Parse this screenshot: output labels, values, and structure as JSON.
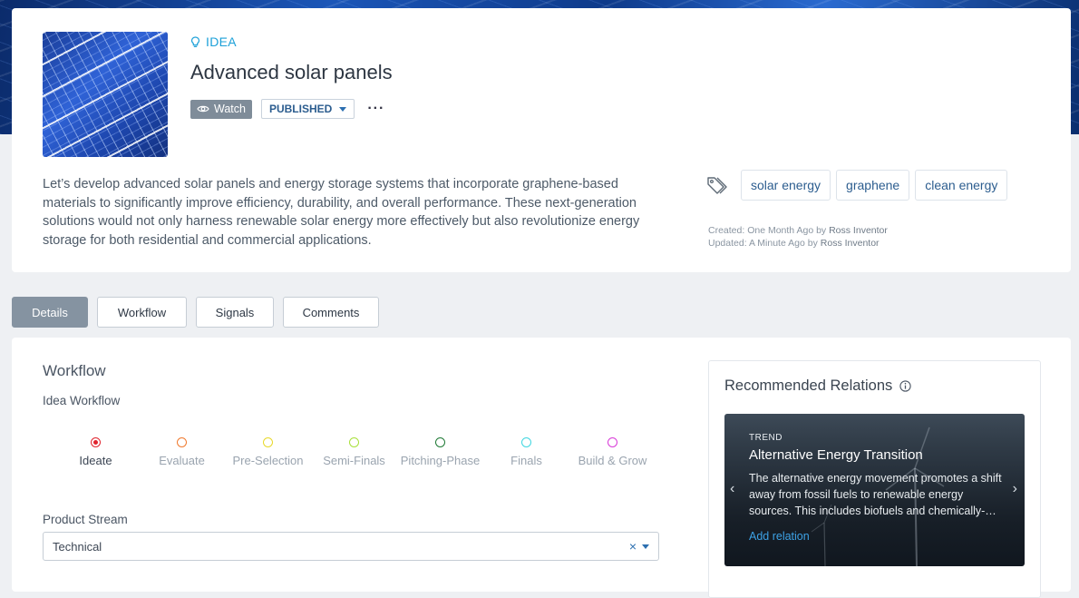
{
  "idea": {
    "type_label": "IDEA",
    "title": "Advanced solar panels",
    "watch_label": "Watch",
    "status_label": "PUBLISHED",
    "more_label": "···",
    "description": "Let’s develop advanced solar panels and energy storage systems that incorporate graphene-based materials to significantly improve efficiency, durability, and overall performance. These next-generation solutions would not only harness renewable solar energy more effectively but also revolutionize energy storage for both residential and commercial applications.",
    "tags": [
      "solar energy",
      "graphene",
      "clean energy"
    ],
    "meta": {
      "created_prefix": "Created: One Month Ago by ",
      "created_by": "Ross Inventor",
      "updated_prefix": "Updated: A Minute Ago by ",
      "updated_by": "Ross Inventor"
    }
  },
  "tabs": [
    {
      "label": "Details",
      "active": true
    },
    {
      "label": "Workflow",
      "active": false
    },
    {
      "label": "Signals",
      "active": false
    },
    {
      "label": "Comments",
      "active": false
    }
  ],
  "workflow": {
    "section_title": "Workflow",
    "workflow_name": "Idea Workflow",
    "stages": [
      {
        "label": "Ideate",
        "color": "#e0242e",
        "current": true
      },
      {
        "label": "Evaluate",
        "color": "#f07a2e",
        "current": false
      },
      {
        "label": "Pre-Selection",
        "color": "#e8d92a",
        "current": false
      },
      {
        "label": "Semi-Finals",
        "color": "#a8e03a",
        "current": false
      },
      {
        "label": "Pitching-Phase",
        "color": "#1f7a35",
        "current": false
      },
      {
        "label": "Finals",
        "color": "#3fd6e0",
        "current": false
      },
      {
        "label": "Build & Grow",
        "color": "#d83ad8",
        "current": false
      }
    ],
    "product_stream_label": "Product Stream",
    "product_stream_value": "Technical",
    "clear_symbol": "×"
  },
  "relations": {
    "title": "Recommended Relations",
    "card": {
      "kicker": "TREND",
      "name": "Alternative Energy Transition",
      "description": "The alternative energy movement promotes a shift away from fossil fuels to renewable energy sources. This includes biofuels and chemically-…",
      "link_label": "Add relation",
      "prev_symbol": "‹",
      "next_symbol": "›"
    }
  },
  "icons": {
    "type": "lightbulb-icon",
    "watch": "eye-icon",
    "status_caret": "caret-down-icon",
    "tags": "tag-icon",
    "info": "info-icon"
  },
  "colors": {
    "accent": "#1ca0d8",
    "link": "#2c5d8f",
    "active_tab": "#8593a1"
  }
}
